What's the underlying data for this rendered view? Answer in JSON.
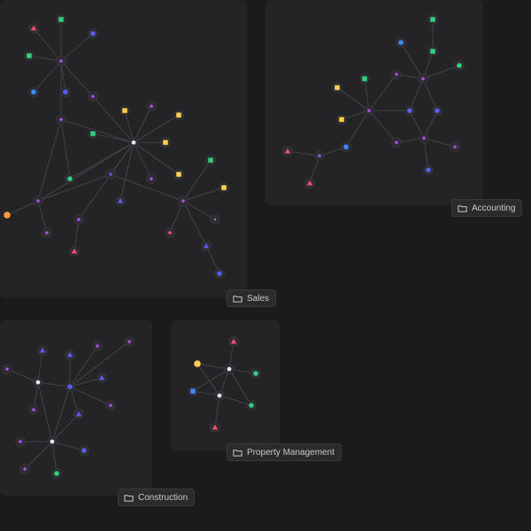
{
  "groups": [
    {
      "id": "sales",
      "label": "Sales"
    },
    {
      "id": "accounting",
      "label": "Accounting"
    },
    {
      "id": "property",
      "label": "Property Management"
    },
    {
      "id": "construction",
      "label": "Construction"
    }
  ],
  "colors": {
    "background": "#1b1b1d",
    "panel": "#242426",
    "edge": "#4a4a50",
    "red": "#ff4d6d",
    "green": "#2fd17f",
    "blue": "#3b8bff",
    "purple": "#a455f0",
    "indigo": "#5b5bf0",
    "yellow": "#ffd04f",
    "orange": "#ff9a3c",
    "white": "#e6e6e6",
    "gray": "#8a8a90"
  }
}
